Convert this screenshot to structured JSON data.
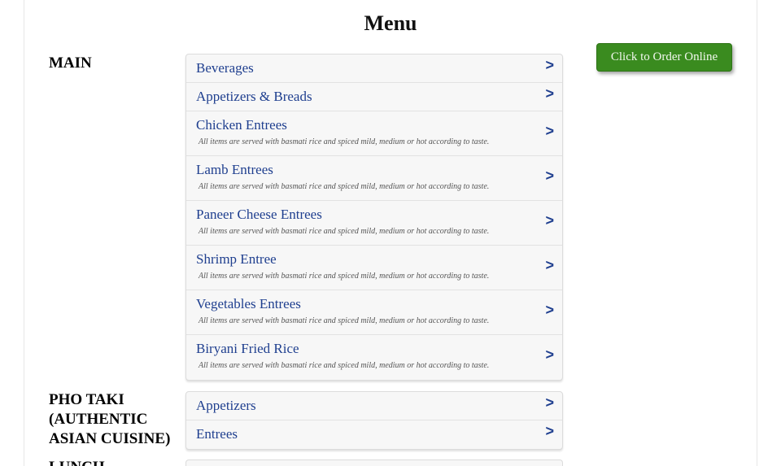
{
  "page": {
    "title": "Menu",
    "order_button_label": "Click to Order Online"
  },
  "sections": [
    {
      "label": "MAIN",
      "items": [
        {
          "name": "Beverages",
          "desc": ""
        },
        {
          "name": "Appetizers & Breads",
          "desc": ""
        },
        {
          "name": "Chicken Entrees",
          "desc": "All items are served with basmati rice and spiced mild, medium or hot according to taste."
        },
        {
          "name": "Lamb Entrees",
          "desc": "All items are served with basmati rice and spiced mild, medium or hot according to taste."
        },
        {
          "name": "Paneer Cheese Entrees",
          "desc": "All items are served with basmati rice and spiced mild, medium or hot according to taste."
        },
        {
          "name": "Shrimp Entree",
          "desc": "All items are served with basmati rice and spiced mild, medium or hot according to taste."
        },
        {
          "name": "Vegetables Entrees",
          "desc": "All items are served with basmati rice and spiced mild, medium or hot according to taste."
        },
        {
          "name": "Biryani Fried Rice",
          "desc": "All items are served with basmati rice and spiced mild, medium or hot according to taste."
        }
      ]
    },
    {
      "label": "PHO TAKI (AUTHENTIC ASIAN CUISINE)",
      "items": [
        {
          "name": "Appetizers",
          "desc": ""
        },
        {
          "name": "Entrees",
          "desc": ""
        }
      ]
    },
    {
      "label": "LUNCH",
      "items": []
    }
  ],
  "chevron_glyph": ">",
  "colors": {
    "link": "#1f3f8f",
    "order_button": "#3a8b1f"
  }
}
